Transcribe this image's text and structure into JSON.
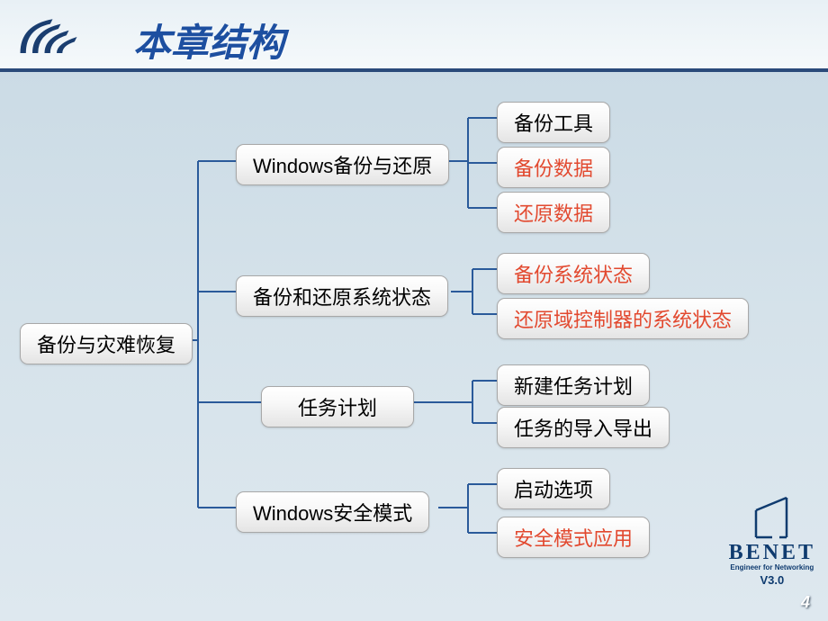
{
  "header": {
    "title": "本章结构"
  },
  "brand": {
    "name": "BENET",
    "sub": "Engineer for Networking",
    "version": "V3.0"
  },
  "page_number": "4",
  "tree": {
    "root": "备份与灾难恢复",
    "branches": [
      {
        "label": "Windows备份与还原",
        "leaves": [
          {
            "text": "备份工具",
            "highlight": false
          },
          {
            "text": "备份数据",
            "highlight": true
          },
          {
            "text": "还原数据",
            "highlight": true
          }
        ]
      },
      {
        "label": "备份和还原系统状态",
        "leaves": [
          {
            "text": "备份系统状态",
            "highlight": true
          },
          {
            "text": "还原域控制器的系统状态",
            "highlight": true
          }
        ]
      },
      {
        "label": "任务计划",
        "leaves": [
          {
            "text": "新建任务计划",
            "highlight": false
          },
          {
            "text": "任务的导入导出",
            "highlight": false
          }
        ]
      },
      {
        "label": "Windows安全模式",
        "leaves": [
          {
            "text": "启动选项",
            "highlight": false
          },
          {
            "text": "安全模式应用",
            "highlight": true
          }
        ]
      }
    ]
  }
}
